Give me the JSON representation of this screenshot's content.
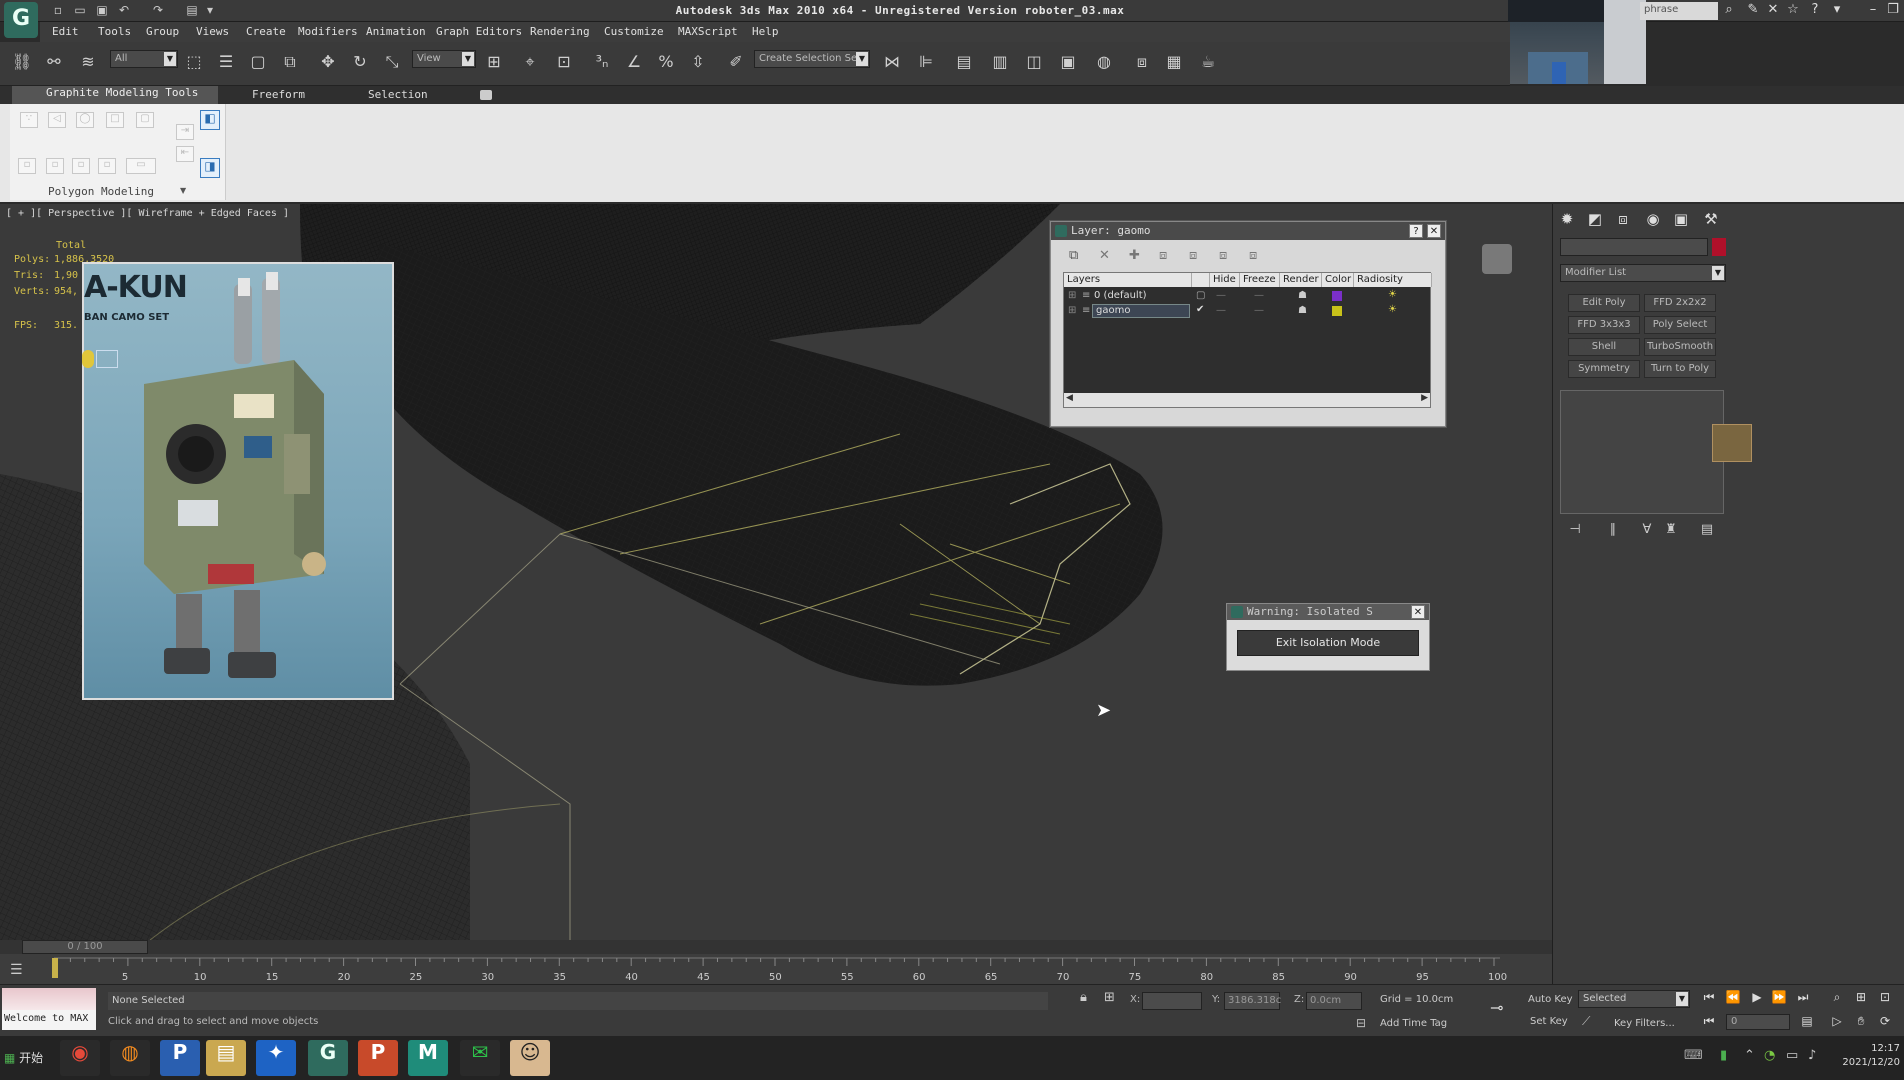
{
  "window": {
    "title": "Autodesk 3ds Max  2010 x64  - Unregistered Version  roboter_03.max",
    "logo_letter": "G",
    "search_placeholder": "phrase"
  },
  "menu": [
    "Edit",
    "Tools",
    "Group",
    "Views",
    "Create",
    "Modifiers",
    "Animation",
    "Graph Editors",
    "Rendering",
    "Customize",
    "MAXScript",
    "Help"
  ],
  "toolbar": {
    "selection_filter": "All",
    "ref_coord": "View",
    "named_selection": "Create Selection Se"
  },
  "ribbon": {
    "tabs": [
      "Graphite Modeling Tools",
      "Freeform",
      "Selection"
    ],
    "panel_label": "Polygon Modeling"
  },
  "viewport": {
    "label": "[ + ][ Perspective ][ Wireframe + Edged Faces ]",
    "stats": {
      "total_label": "Total",
      "polys_label": "Polys:",
      "polys_value": "1,886,3520",
      "tris_label": "Tris:",
      "tris_value": "1,90",
      "verts_label": "Verts:",
      "verts_value": "954,",
      "fps_label": "FPS:",
      "fps_value": "315."
    },
    "ref_image": {
      "title": "A-KUN",
      "subtitle": "BAN CAMO SET"
    }
  },
  "layer_dialog": {
    "title": "Layer: gaomo",
    "columns": [
      "Layers",
      "",
      "Hide",
      "Freeze",
      "Render",
      "Color",
      "Radiosity"
    ],
    "rows": [
      {
        "name": "0 (default)",
        "color": "#7a2fc8"
      },
      {
        "name": "gaomo",
        "color": "#c8c21a"
      }
    ]
  },
  "warning_dialog": {
    "title": "Warning: Isolated S",
    "button": "Exit Isolation Mode"
  },
  "command_panel": {
    "modifier_list": "Modifier List",
    "buttons": [
      "Edit Poly",
      "FFD 2x2x2",
      "FFD 3x3x3",
      "Poly Select",
      "Shell",
      "TurboSmooth",
      "Symmetry",
      "Turn to Poly"
    ],
    "object_color": "#b0102a"
  },
  "timeline": {
    "frame_indicator": "0 / 100",
    "ticks": [
      "5",
      "10",
      "15",
      "20",
      "25",
      "30",
      "35",
      "40",
      "45",
      "50",
      "55",
      "60",
      "65",
      "70",
      "75",
      "80",
      "85",
      "90",
      "95",
      "100"
    ]
  },
  "status": {
    "welcome": "Welcome to MAX",
    "selection": "None Selected",
    "prompt": "Click and drag to select and move objects",
    "x_label": "X:",
    "x_value": "",
    "y_label": "Y:",
    "y_value": "3186.318c",
    "z_label": "Z:",
    "z_value": "0.0cm",
    "grid": "Grid = 10.0cm",
    "add_time_tag": "Add Time Tag",
    "auto_key": "Auto Key",
    "set_key": "Set Key",
    "key_mode": "Selected",
    "key_filters": "Key Filters...",
    "frame": "0"
  },
  "taskbar": {
    "start": "开始",
    "apps": [
      "chrome",
      "firefox",
      "P",
      "folder",
      "feather",
      "3dsmax",
      "P",
      "M",
      "wechat",
      "user"
    ],
    "time": "12:17",
    "date": "2021/12/20"
  }
}
